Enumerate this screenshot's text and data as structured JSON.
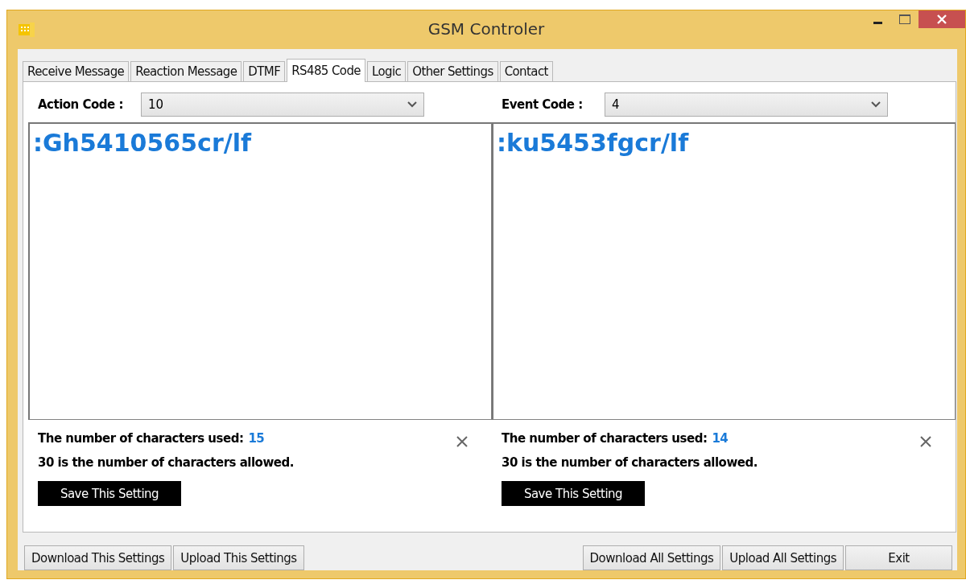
{
  "window": {
    "title": "GSM Controler"
  },
  "tabs": [
    {
      "label": "Receive Message",
      "selected": false
    },
    {
      "label": "Reaction Message",
      "selected": false
    },
    {
      "label": "DTMF",
      "selected": false
    },
    {
      "label": "RS485 Code",
      "selected": true
    },
    {
      "label": "Logic",
      "selected": false
    },
    {
      "label": "Other Settings",
      "selected": false
    },
    {
      "label": "Contact",
      "selected": false
    }
  ],
  "panels": [
    {
      "label": "Action Code :",
      "value": "10",
      "text": ":Gh5410565cr/lf",
      "used_label": "The number of characters used:",
      "used_count": "15",
      "allowed": "30 is the number of characters allowed.",
      "save": "Save This Setting"
    },
    {
      "label": "Event Code :",
      "value": "4",
      "text": ":ku5453fgcr/lf",
      "used_label": "The number of characters used:",
      "used_count": "14",
      "allowed": "30 is the number of characters allowed.",
      "save": "Save This Setting"
    }
  ],
  "buttons_left": [
    "Download This Settings",
    "Upload This Settings"
  ],
  "buttons_right": [
    "Download All Settings",
    "Upload All Settings",
    "Exit"
  ]
}
